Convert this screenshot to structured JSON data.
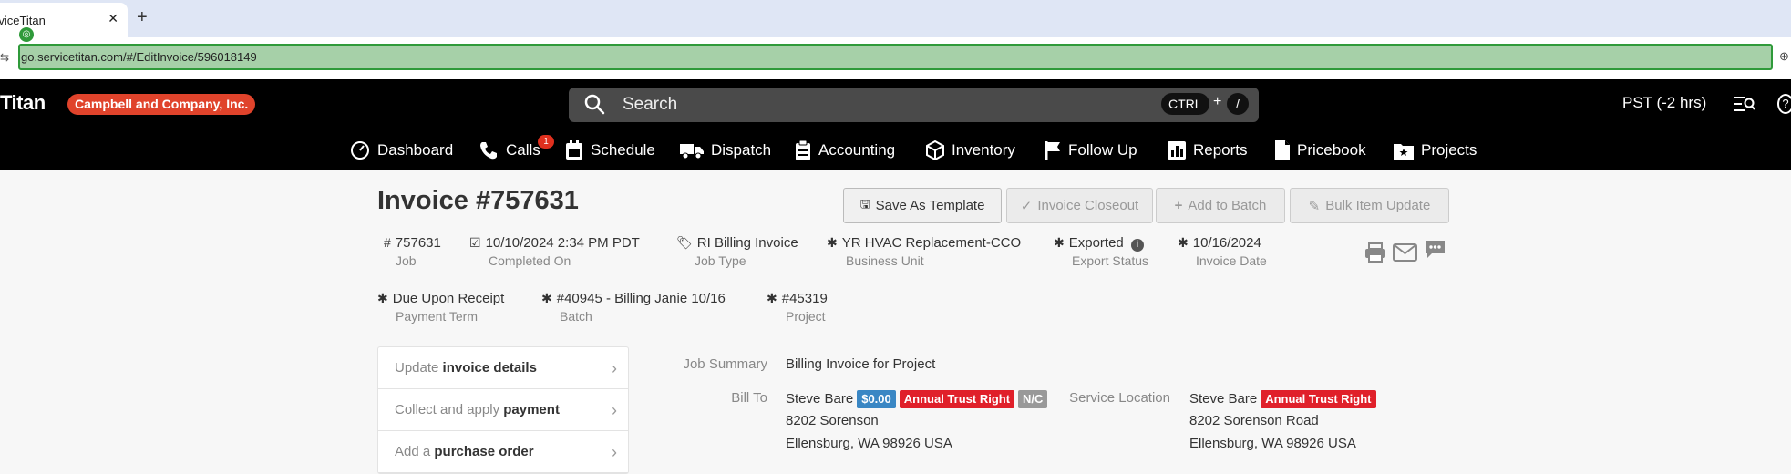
{
  "browser": {
    "tab_title": "rviceTitan",
    "url": "go.servicetitan.com/#/EditInvoice/596018149"
  },
  "header": {
    "logo": "Titan",
    "company": "Campbell and Company, Inc.",
    "search_placeholder": "Search",
    "kbd_ctrl": "CTRL",
    "kbd_plus": "+",
    "kbd_slash": "/",
    "timezone": "PST (-2 hrs)"
  },
  "nav": [
    {
      "label": "Dashboard",
      "icon": "dashboard-icon"
    },
    {
      "label": "Calls",
      "icon": "phone-icon",
      "badge": "1"
    },
    {
      "label": "Schedule",
      "icon": "calendar-icon"
    },
    {
      "label": "Dispatch",
      "icon": "truck-icon"
    },
    {
      "label": "Accounting",
      "icon": "clipboard-icon"
    },
    {
      "label": "Inventory",
      "icon": "box-icon"
    },
    {
      "label": "Follow Up",
      "icon": "flag-icon"
    },
    {
      "label": "Reports",
      "icon": "bar-chart-icon"
    },
    {
      "label": "Pricebook",
      "icon": "book-icon"
    },
    {
      "label": "Projects",
      "icon": "folder-star-icon"
    }
  ],
  "invoice": {
    "title": "Invoice #757631",
    "buttons": {
      "save_template": "Save As Template",
      "closeout": "Invoice Closeout",
      "add_batch": "Add to Batch",
      "bulk_update": "Bulk Item Update"
    },
    "meta": [
      {
        "value": "757631",
        "label": "Job",
        "icon": "#"
      },
      {
        "value": "10/10/2024 2:34 PM PDT",
        "label": "Completed On",
        "icon": "checkbox-icon"
      },
      {
        "value": "RI Billing Invoice",
        "label": "Job Type",
        "icon": "tag-icon"
      },
      {
        "value": "YR HVAC Replacement-CCO",
        "label": "Business Unit",
        "icon": "asterisk-icon"
      },
      {
        "value": "Exported",
        "label": "Export Status",
        "icon": "asterisk-icon"
      },
      {
        "value": "10/16/2024",
        "label": "Invoice Date",
        "icon": "asterisk-icon"
      },
      {
        "value": "Due Upon Receipt",
        "label": "Payment Term",
        "icon": "asterisk-icon"
      },
      {
        "value": "#40945 - Billing Janie 10/16",
        "label": "Batch",
        "icon": "asterisk-icon"
      },
      {
        "value": "#45319",
        "label": "Project",
        "icon": "asterisk-icon"
      }
    ],
    "side_panel": [
      {
        "prefix": "Update ",
        "bold": "invoice details"
      },
      {
        "prefix": "Collect and apply ",
        "bold": "payment"
      },
      {
        "prefix": "Add a ",
        "bold": "purchase order"
      }
    ],
    "job_summary_label": "Job Summary",
    "job_summary_value": "Billing Invoice for Project",
    "bill_to_label": "Bill To",
    "bill_to": {
      "name": "Steve Bare",
      "balance": "$0.00",
      "tag": "Annual Trust Right",
      "nc": "N/C",
      "address1": "8202 Sorenson",
      "address2": "Ellensburg, WA 98926 USA"
    },
    "service_location_label": "Service Location",
    "service_location": {
      "name": "Steve Bare",
      "tag": "Annual Trust Right",
      "address1": "8202 Sorenson Road",
      "address2": "Ellensburg, WA 98926 USA"
    }
  }
}
